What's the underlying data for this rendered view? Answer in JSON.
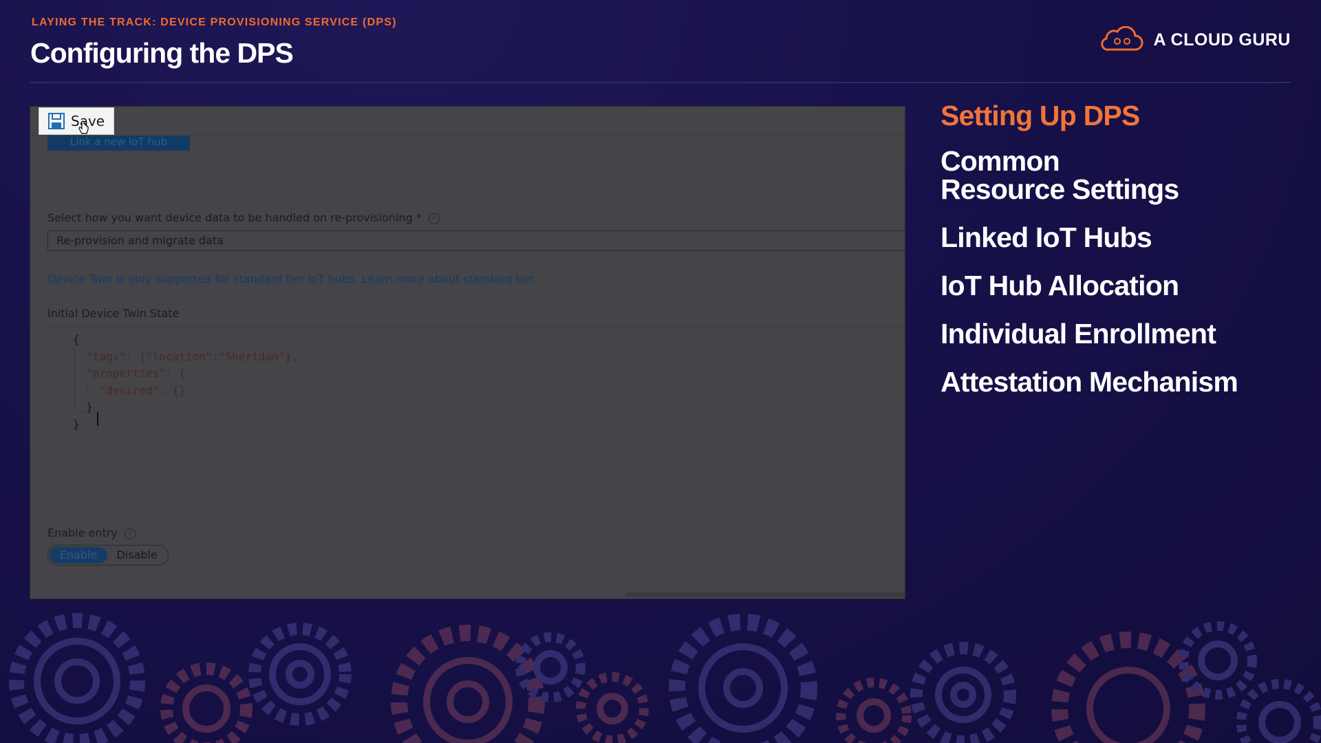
{
  "header": {
    "eyebrow": "LAYING THE TRACK: DEVICE PROVISIONING SERVICE (DPS)",
    "title": "Configuring the DPS",
    "brand": "A CLOUD GURU"
  },
  "screenshot": {
    "save_label": "Save",
    "link_hub_label": "Link a new IoT hub",
    "reprovision_label": "Select how you want device data to be handled on re-provisioning *",
    "reprovision_value": "Re-provision and migrate data",
    "notice": "Device Twin is only supported for standard tier IoT hubs. Learn more about standard tier.",
    "twin_label": "Initial Device Twin State",
    "twin_lines": [
      "{",
      "  \"tags\": {\"location\":\"Sheridan\"},",
      "  \"properties\": {",
      "    \"desired\": {}",
      "  }",
      "}"
    ],
    "enable_entry_label": "Enable entry",
    "toggle": {
      "on": "Enable",
      "off": "Disable",
      "selected": "Enable"
    }
  },
  "agenda": {
    "items": [
      {
        "label": "Setting Up DPS",
        "active": true
      },
      {
        "label": "Common\nResource Settings",
        "active": false
      },
      {
        "label": "Linked IoT Hubs",
        "active": false
      },
      {
        "label": "IoT Hub Allocation",
        "active": false
      },
      {
        "label": "Individual Enrollment",
        "active": false
      },
      {
        "label": "Attestation Mechanism",
        "active": false
      }
    ]
  },
  "colors": {
    "accent": "#f26b2b",
    "background": "#17114a",
    "gear_orange": "#7a3a4e",
    "gear_blue": "#3c3a7e"
  },
  "icons": [
    "cloud-logo-icon",
    "save-disk-icon",
    "hand-cursor-icon",
    "info-icon",
    "gear-icon"
  ]
}
